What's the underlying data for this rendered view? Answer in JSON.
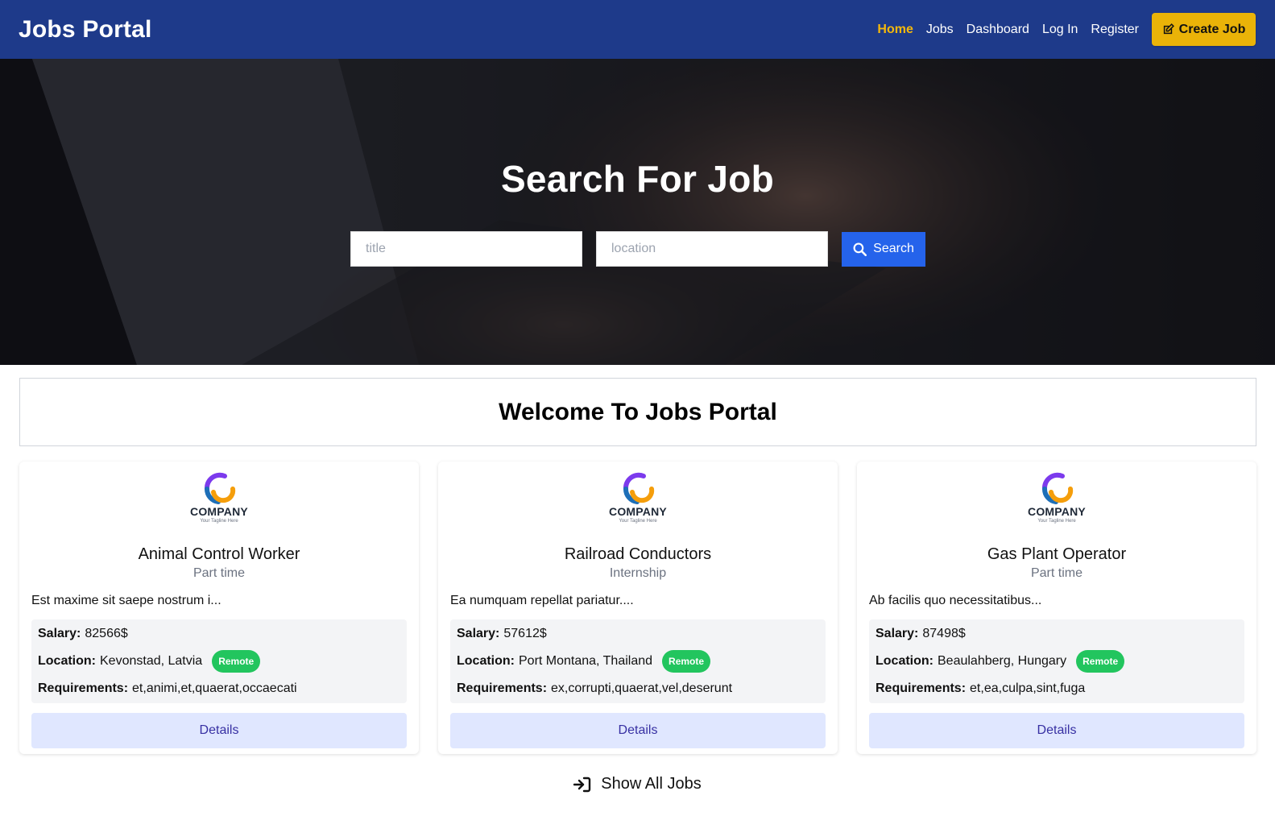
{
  "navbar": {
    "brand": "Jobs Portal",
    "links": [
      {
        "label": "Home",
        "active": true
      },
      {
        "label": "Jobs"
      },
      {
        "label": "Dashboard"
      },
      {
        "label": "Log In"
      },
      {
        "label": "Register"
      }
    ],
    "create_button": "Create Job"
  },
  "hero": {
    "title": "Search For Job",
    "title_placeholder": "title",
    "location_placeholder": "location",
    "search_button": "Search"
  },
  "welcome": {
    "heading": "Welcome To Jobs Portal"
  },
  "jobs": [
    {
      "logo_word": "COMPANY",
      "logo_tagline": "Your Tagline Here",
      "title": "Animal Control Worker",
      "type": "Part time",
      "description": "Est maxime sit saepe nostrum i...",
      "salary_label": "Salary:",
      "salary": "82566$",
      "location_label": "Location:",
      "location": "Kevonstad, Latvia",
      "badge": "Remote",
      "requirements_label": "Requirements:",
      "requirements": "et,animi,et,quaerat,occaecati",
      "details_button": "Details"
    },
    {
      "logo_word": "COMPANY",
      "logo_tagline": "Your Tagline Here",
      "title": "Railroad Conductors",
      "type": "Internship",
      "description": "Ea numquam repellat pariatur....",
      "salary_label": "Salary:",
      "salary": "57612$",
      "location_label": "Location:",
      "location": "Port Montana, Thailand",
      "badge": "Remote",
      "requirements_label": "Requirements:",
      "requirements": "ex,corrupti,quaerat,vel,deserunt",
      "details_button": "Details"
    },
    {
      "logo_word": "COMPANY",
      "logo_tagline": "Your Tagline Here",
      "title": "Gas Plant Operator",
      "type": "Part time",
      "description": "Ab facilis quo necessitatibus...",
      "salary_label": "Salary:",
      "salary": "87498$",
      "location_label": "Location:",
      "location": "Beaulahberg, Hungary",
      "badge": "Remote",
      "requirements_label": "Requirements:",
      "requirements": "et,ea,culpa,sint,fuga",
      "details_button": "Details"
    }
  ],
  "show_all": "Show All Jobs",
  "colors": {
    "navbar": "#1e3a8a",
    "active_link": "#f5b80b",
    "create_button": "#eab308",
    "search_button": "#2563eb",
    "remote_badge": "#22c55e",
    "details_button_bg": "#e0e7ff",
    "details_button_text": "#3730a3"
  },
  "icons": {
    "create_button": "edit-icon",
    "search_button": "search-icon",
    "show_all": "sign-in-arrow-icon"
  }
}
